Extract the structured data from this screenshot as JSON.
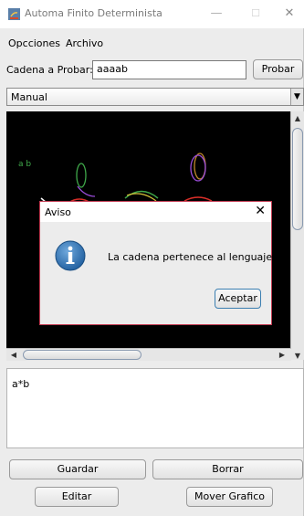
{
  "window": {
    "title": "Automa Finito Determinista",
    "controls": {
      "minimize": "—",
      "maximize": "☐",
      "close": "✕"
    }
  },
  "menu": {
    "items": [
      "Opcciones",
      "Archivo"
    ]
  },
  "input": {
    "label": "Cadena a Probar:",
    "value": "aaaab",
    "test_button": "Probar"
  },
  "mode_select": {
    "value": "Manual"
  },
  "canvas": {
    "label": "a b"
  },
  "dialog": {
    "title": "Aviso",
    "close": "✕",
    "message": "La cadena  pertenece al lenguaje",
    "ok_button": "Aceptar",
    "icon": "info-icon"
  },
  "expression": {
    "value": "a*b"
  },
  "buttons": {
    "save": "Guardar",
    "delete": "Borrar",
    "edit": "Editar",
    "move_graph": "Mover Grafico"
  },
  "colors": {
    "canvas_bg": "#000000",
    "dialog_border": "#c23b52",
    "info_icon": "#2a6fb0"
  }
}
